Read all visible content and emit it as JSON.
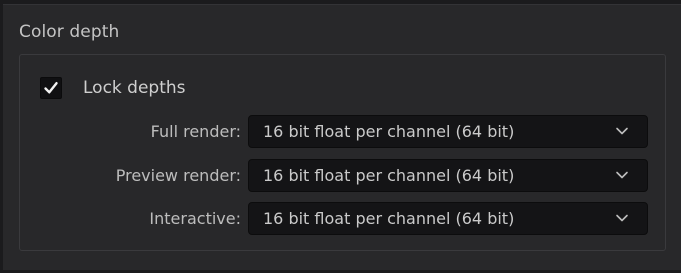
{
  "panel": {
    "title": "Color depth"
  },
  "lock": {
    "label": "Lock depths",
    "checked": true
  },
  "fields": [
    {
      "label": "Full render:",
      "value": "16 bit float per channel (64 bit)"
    },
    {
      "label": "Preview render:",
      "value": "16 bit float per channel (64 bit)"
    },
    {
      "label": "Interactive:",
      "value": "16 bit float per channel (64 bit)"
    }
  ],
  "icons": {
    "checkbox": "checkmark-icon",
    "dropdown": "chevron-down-icon"
  }
}
